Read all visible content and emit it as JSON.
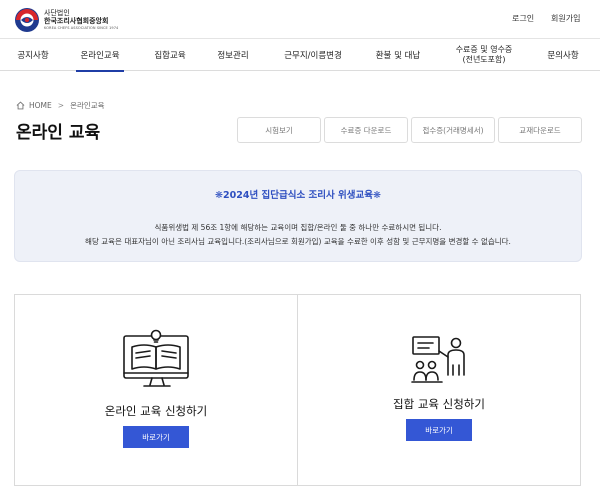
{
  "header": {
    "logo": {
      "line1": "사단법인",
      "line2": "한국조리사협회중앙회",
      "line3": "KOREA CHEFS ASSOCIATION SINCE 1974"
    },
    "util": {
      "login": "로그인",
      "join": "회원가입"
    }
  },
  "nav": {
    "items": [
      {
        "label": "공지사항"
      },
      {
        "label": "온라인교육"
      },
      {
        "label": "집합교육"
      },
      {
        "label": "정보관리"
      },
      {
        "label": "근무지/이름변경"
      },
      {
        "label": "환불 및 대납"
      },
      {
        "label": "수료증 및 영수증",
        "label2": "(전년도포함)"
      },
      {
        "label": "문의사항"
      }
    ],
    "active_index": 1
  },
  "breadcrumb": {
    "home": "HOME",
    "separator": ">",
    "current": "온라인교육"
  },
  "page_title": "온라인 교육",
  "tab_buttons": [
    "시험보기",
    "수료증 다운로드",
    "접수증(거래명세서)",
    "교재다운로드"
  ],
  "notice": {
    "title": "❋2024년 집단급식소 조리사 위생교육❋",
    "line1": "식품위생법 제 56조 1항에 해당하는 교육이며 집합/온라인 둘 중 하나만 수료하시면 됩니다.",
    "line2": "해당 교육은 대표자님이 아닌 조리사님 교육입니다.(조리사님으로 회원가입) 교육을 수료한 이후 성함 및 근무지명을 변경할 수 없습니다."
  },
  "cards": [
    {
      "title": "온라인 교육 신청하기",
      "button": "바로가기",
      "icon": "online-lecture-icon"
    },
    {
      "title": "집합 교육 신청하기",
      "button": "바로가기",
      "icon": "classroom-lecture-icon"
    }
  ],
  "colors": {
    "accent": "#1f3da6",
    "button": "#3457d5",
    "notice_bg": "#eef1f8",
    "notice_title": "#2e4fc0"
  }
}
